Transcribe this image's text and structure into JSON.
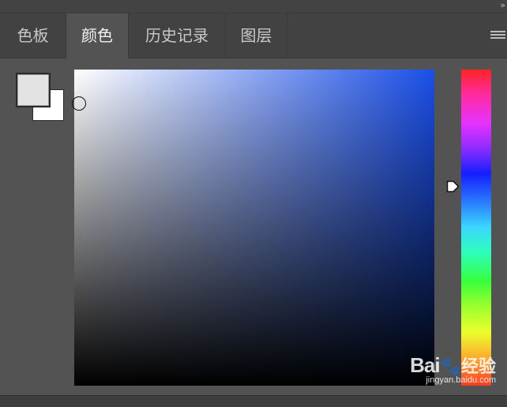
{
  "panel": {
    "tabs": [
      {
        "label": "色板",
        "active": false
      },
      {
        "label": "颜色",
        "active": true
      },
      {
        "label": "历史记录",
        "active": false
      },
      {
        "label": "图层",
        "active": false
      }
    ]
  },
  "colors": {
    "foreground": "#E3E3E3",
    "background": "#FFFFFF",
    "selected_hue": "#1A4FE8"
  },
  "watermark": {
    "logo_text": "Bai",
    "logo_cn": "经验",
    "url": "jingyan.baidu.com"
  }
}
